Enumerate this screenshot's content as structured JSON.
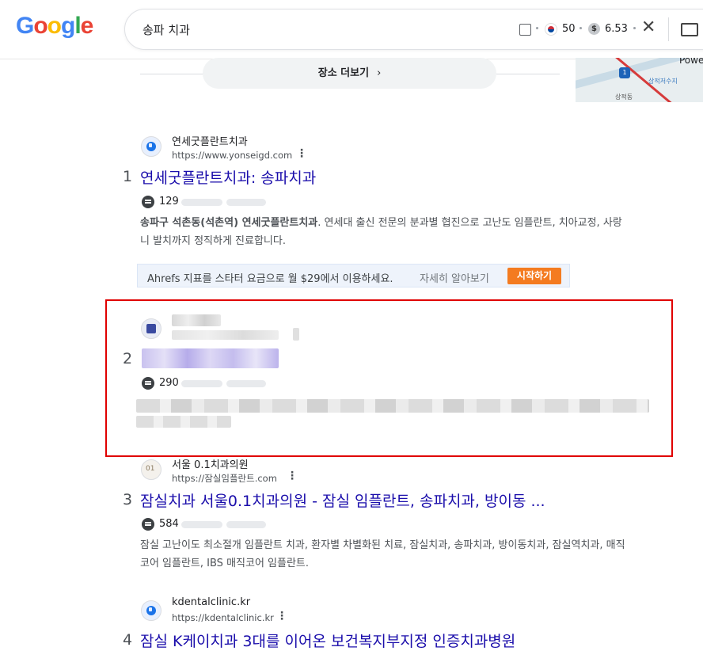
{
  "header": {
    "logo": [
      "G",
      "o",
      "o",
      "g",
      "l",
      "e"
    ],
    "logo_colors": [
      "#4285F4",
      "#EA4335",
      "#FBBC05",
      "#4285F4",
      "#34A853",
      "#EA4335"
    ],
    "query": "송파 치과",
    "flag_value": "50",
    "dollar_symbol": "$",
    "price_value": "6.53"
  },
  "places": {
    "more_label": "장소 더보기",
    "map_labels": [
      "상적저수지",
      "상적동"
    ],
    "map_route": "1",
    "map_edge_text": "Powe"
  },
  "results": [
    {
      "rank": "1",
      "site": "연세굿플란트치과",
      "url": "https://www.yonseigd.com",
      "title": "연세굿플란트치과: 송파치과",
      "comments": "129",
      "desc_line1_bold1": "송파구 석촌동(석촌역) 연세굿플란트치과",
      "desc_line1_rest": ". 연세대 출신 전문의 분과별 협진으로 고난도 임플란트, 치아교정, 사랑",
      "desc_line2": "니 발치까지 정직하게 진료합니다."
    },
    {
      "rank": "2",
      "comments": "290"
    },
    {
      "rank": "3",
      "site": "서울 0.1치과의원",
      "url": "https://잠실임플란트.com",
      "title": "잠실치과 서울0.1치과의원 - 잠실 임플란트, 송파치과, 방이동 ...",
      "comments": "584",
      "desc_line1": "잠실 고난이도 최소절개 임플란트 치과, 환자별 차별화된 치료, 잠실치과, 송파치과, 방이동치과, 잠실역치과, 매직",
      "desc_line2": "코어 임플란트, IBS 매직코어 임플란트."
    },
    {
      "rank": "4",
      "site": "kdentalclinic.kr",
      "url": "https://kdentalclinic.kr",
      "title": "잠실 K케이치과 3대를 이어온 보건복지부지정 인증치과병원"
    }
  ],
  "ahrefs": {
    "text": "Ahrefs 지표를 스타터 요금으로 월 $29에서 이용하세요.",
    "learn_more": "자세히 알아보기",
    "start": "시작하기"
  },
  "icons": [
    "globe-icon",
    "comment-icon",
    "more-vert-icon",
    "close-icon",
    "keyboard-icon"
  ]
}
